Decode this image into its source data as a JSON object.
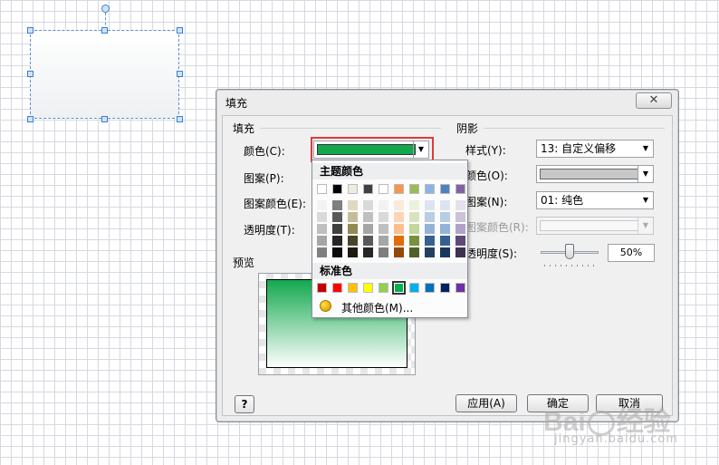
{
  "dialog": {
    "title": "填充",
    "close_label": "✕",
    "fill_section": "填充",
    "shadow_section": "阴影",
    "preview_section": "预览",
    "fill": {
      "color_label": "颜色(C):",
      "pattern_label": "图案(P):",
      "pattern_color_label": "图案颜色(E):",
      "transparency_label": "透明度(T):",
      "color_value_hex": "#13a84e"
    },
    "shadow": {
      "style_label": "样式(Y):",
      "style_value": "13: 自定义偏移",
      "color_label": "颜色(O):",
      "color_value_hex": "#c8c8c8",
      "pattern_label": "图案(N):",
      "pattern_value": "01: 纯色",
      "pattern_color_label": "图案颜色(R):",
      "transparency_label": "透明度(S):",
      "transparency_value": "50%",
      "transparency_level": 0.5
    },
    "buttons": {
      "help": "?",
      "apply": "应用(A)",
      "ok": "确定",
      "cancel": "取消"
    }
  },
  "color_popup": {
    "theme_title": "主题颜色",
    "standard_title": "标准色",
    "more_colors": "其他颜色(M)...",
    "theme_top": [
      "#ffffff",
      "#000000",
      "#eeece1",
      "#404040",
      "#ffffff",
      "#f79646",
      "#9bbb59",
      "#8db3e2",
      "#4f81bd",
      "#8064a2"
    ],
    "theme_columns": [
      [
        "#f2f2f2",
        "#d9d9d9",
        "#bfbfbf",
        "#a6a6a6",
        "#808080"
      ],
      [
        "#7f7f7f",
        "#595959",
        "#404040",
        "#262626",
        "#0d0d0d"
      ],
      [
        "#ddd9c3",
        "#c4bd97",
        "#938953",
        "#494429",
        "#1d1b10"
      ],
      [
        "#d9d9d9",
        "#bfbfbf",
        "#a6a6a6",
        "#595959",
        "#262626"
      ],
      [
        "#f2f2f2",
        "#d9d9d9",
        "#bfbfbf",
        "#a6a6a6",
        "#7f7f7f"
      ],
      [
        "#fde9d9",
        "#fbd5b5",
        "#fac08f",
        "#e36c09",
        "#974806"
      ],
      [
        "#ebf1dd",
        "#d7e3bc",
        "#c3d69b",
        "#76923c",
        "#4f6128"
      ],
      [
        "#dbe5f1",
        "#b8cce4",
        "#95b3d7",
        "#366092",
        "#244061"
      ],
      [
        "#dbe5f1",
        "#b8cce4",
        "#95b3d7",
        "#366092",
        "#17375e"
      ],
      [
        "#e5e0ec",
        "#ccc1d9",
        "#b2a2c7",
        "#5f497a",
        "#3f3151"
      ]
    ],
    "standard": [
      "#c00000",
      "#ff0000",
      "#ffc000",
      "#ffff00",
      "#92d050",
      "#00b050",
      "#00b0f0",
      "#0070c0",
      "#002060",
      "#7030a0"
    ],
    "selected_standard_index": 5
  },
  "watermark": {
    "brand": "Bai",
    "cn": "经验",
    "url": "jingyan.baidu.com"
  }
}
